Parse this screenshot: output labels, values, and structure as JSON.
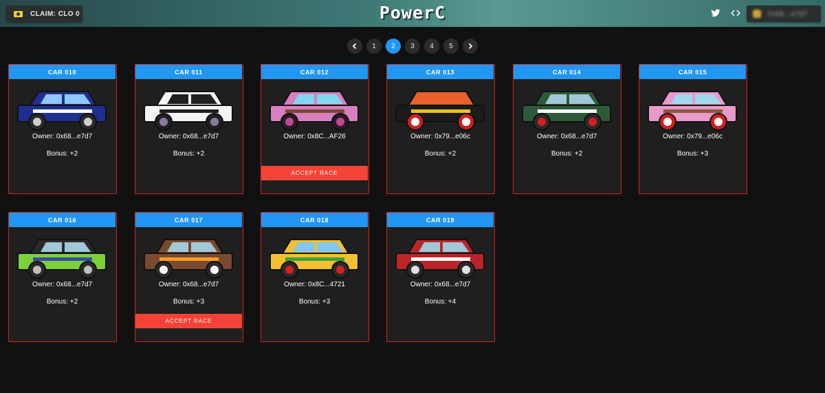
{
  "header": {
    "claim_label": "CLAIM: CLO 0",
    "logo_text": "PowerC",
    "wallet_address": "0x68...e7d7",
    "accent": "#2196f3"
  },
  "pagination": {
    "prev_icon": "chevron-left-icon",
    "next_icon": "chevron-right-icon",
    "pages": [
      "1",
      "2",
      "3",
      "4",
      "5"
    ],
    "current": "2"
  },
  "cards": [
    {
      "title": "CAR 010",
      "owner": "Owner: 0x68...e7d7",
      "bonus": "Bonus: +2",
      "accept": "",
      "body": "#1f2f8f",
      "roof": "#1f2f8f",
      "window": "#8fc8ff",
      "wheel": "#2a2a2a",
      "rim": "#cfcfcf",
      "stripe": "#ffffff"
    },
    {
      "title": "CAR 011",
      "owner": "Owner: 0x68...e7d7",
      "bonus": "Bonus: +2",
      "accept": "",
      "body": "#f4f4f4",
      "roof": "#f4f4f4",
      "window": "#202020",
      "wheel": "#202020",
      "rim": "#8a7a9a",
      "stripe": "#202020"
    },
    {
      "title": "CAR 012",
      "owner": "Owner: 0x8C...AF26",
      "bonus": "",
      "accept": "ACCEPT RACE",
      "body": "#d97fc0",
      "roof": "#d97fc0",
      "window": "#80d8f0",
      "wheel": "#2a1a2a",
      "rim": "#c04a90",
      "stripe": "#7a4a30"
    },
    {
      "title": "CAR 013",
      "owner": "Owner: 0x79...e06c",
      "bonus": "Bonus: +2",
      "accept": "",
      "body": "#1b1b1b",
      "roof": "#e8602a",
      "window": "#e8602a",
      "wheel": "#d22020",
      "rim": "#ffffff",
      "stripe": "#f5c020"
    },
    {
      "title": "CAR 014",
      "owner": "Owner: 0x68...e7d7",
      "bonus": "Bonus: +2",
      "accept": "",
      "body": "#2e5a3a",
      "roof": "#2e5a3a",
      "window": "#a0c8d8",
      "wheel": "#2a2a2a",
      "rim": "#d22020",
      "stripe": "#ffffff"
    },
    {
      "title": "CAR 015",
      "owner": "Owner: 0x79...e06c",
      "bonus": "Bonus: +3",
      "accept": "",
      "body": "#e89ac8",
      "roof": "#e89ac8",
      "window": "#a0d8f0",
      "wheel": "#d22020",
      "rim": "#ffffff",
      "stripe": "#8a5a3a"
    },
    {
      "title": "CAR 016",
      "owner": "Owner: 0x68...e7d7",
      "bonus": "Bonus: +2",
      "accept": "",
      "body": "#7cd03a",
      "roof": "#2a2a2a",
      "window": "#a0c8d8",
      "wheel": "#2a2a2a",
      "rim": "#bfbfbf",
      "stripe": "#3a4aa8"
    },
    {
      "title": "CAR 017",
      "owner": "Owner: 0x68...e7d7",
      "bonus": "Bonus: +3",
      "accept": "ACCEPT RACE",
      "body": "#7a4a30",
      "roof": "#7a4a30",
      "window": "#a0c8d8",
      "wheel": "#2a2a2a",
      "rim": "#ffffff",
      "stripe": "#f5a020"
    },
    {
      "title": "CAR 018",
      "owner": "Owner: 0x8C...4721",
      "bonus": "Bonus: +3",
      "accept": "",
      "body": "#f2c030",
      "roof": "#f2c030",
      "window": "#80c8f0",
      "wheel": "#2a2a2a",
      "rim": "#d22020",
      "stripe": "#3aa040"
    },
    {
      "title": "CAR 019",
      "owner": "Owner: 0x68...e7d7",
      "bonus": "Bonus: +4",
      "accept": "",
      "body": "#b8262a",
      "roof": "#b8262a",
      "window": "#a0c8d8",
      "wheel": "#2a2a2a",
      "rim": "#e0e0e0",
      "stripe": "#ffffff"
    }
  ]
}
